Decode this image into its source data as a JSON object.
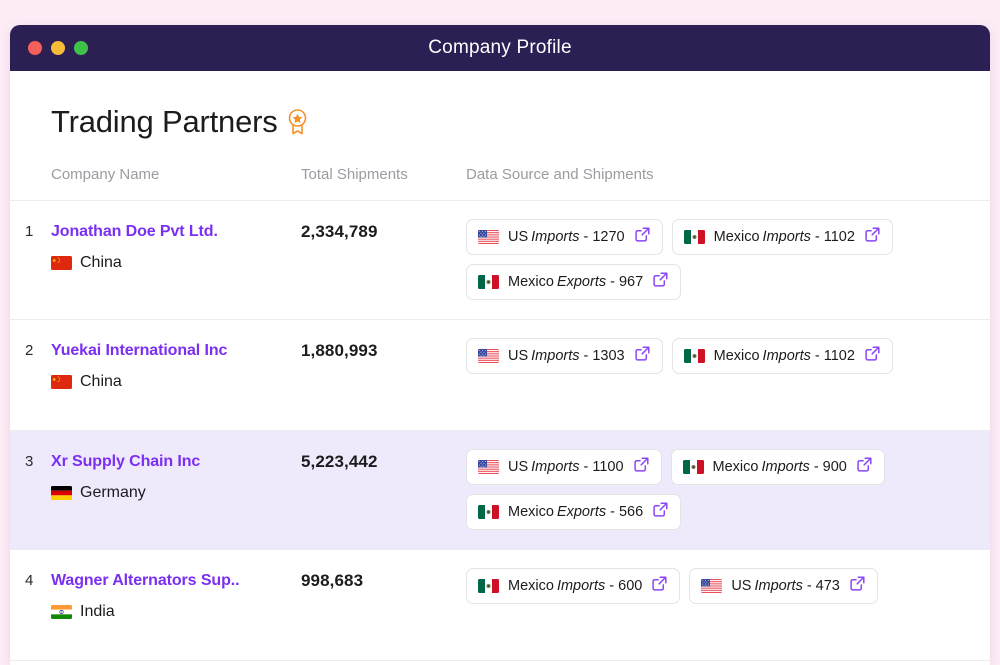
{
  "window": {
    "title": "Company Profile",
    "traffic_lights": [
      {
        "name": "close",
        "color": "#f4605a"
      },
      {
        "name": "minimize",
        "color": "#f5bc38"
      },
      {
        "name": "maximize",
        "color": "#3fc24a"
      }
    ]
  },
  "page": {
    "title": "Trading Partners",
    "title_badge_icon": "award-badge-icon",
    "accent_color": "#7a2ff2",
    "titlebar_color": "#2c1f54",
    "page_background": "#fdecf6",
    "highlight_row_color": "#efe9fc"
  },
  "table": {
    "columns": [
      {
        "key": "index",
        "label": ""
      },
      {
        "key": "company_name",
        "label": "Company Name"
      },
      {
        "key": "total_shipments",
        "label": "Total Shipments"
      },
      {
        "key": "data_source",
        "label": "Data Source and Shipments"
      }
    ],
    "rows": [
      {
        "index": "1",
        "company_name": "Jonathan Doe Pvt Ltd.",
        "country": "China",
        "country_flag": "flag-china",
        "total_shipments": "2,334,789",
        "highlighted": false,
        "chips": [
          {
            "flag": "flag-us",
            "country": "US",
            "direction": "Imports",
            "count": "1270",
            "link_icon": "external-link-icon"
          },
          {
            "flag": "flag-mexico",
            "country": "Mexico",
            "direction": "Imports",
            "count": "1102",
            "link_icon": "external-link-icon"
          },
          {
            "flag": "flag-mexico",
            "country": "Mexico",
            "direction": "Exports",
            "count": "967",
            "link_icon": "external-link-icon"
          }
        ]
      },
      {
        "index": "2",
        "company_name": "Yuekai International Inc",
        "country": "China",
        "country_flag": "flag-china",
        "total_shipments": "1,880,993",
        "highlighted": false,
        "chips": [
          {
            "flag": "flag-us",
            "country": "US",
            "direction": "Imports",
            "count": "1303",
            "link_icon": "external-link-icon"
          },
          {
            "flag": "flag-mexico",
            "country": "Mexico",
            "direction": "Imports",
            "count": "1102",
            "link_icon": "external-link-icon"
          }
        ]
      },
      {
        "index": "3",
        "company_name": "Xr Supply Chain Inc",
        "country": "Germany",
        "country_flag": "flag-germany",
        "total_shipments": "5,223,442",
        "highlighted": true,
        "chips": [
          {
            "flag": "flag-us",
            "country": "US",
            "direction": "Imports",
            "count": "1100",
            "link_icon": "external-link-icon"
          },
          {
            "flag": "flag-mexico",
            "country": "Mexico",
            "direction": "Imports",
            "count": "900",
            "link_icon": "external-link-icon"
          },
          {
            "flag": "flag-mexico",
            "country": "Mexico",
            "direction": "Exports",
            "count": "566",
            "link_icon": "external-link-icon"
          }
        ]
      },
      {
        "index": "4",
        "company_name": "Wagner Alternators Sup..",
        "country": "India",
        "country_flag": "flag-india",
        "total_shipments": "998,683",
        "highlighted": false,
        "chips": [
          {
            "flag": "flag-mexico",
            "country": "Mexico",
            "direction": "Imports",
            "count": "600",
            "link_icon": "external-link-icon"
          },
          {
            "flag": "flag-us",
            "country": "US",
            "direction": "Imports",
            "count": "473",
            "link_icon": "external-link-icon"
          }
        ]
      }
    ]
  }
}
